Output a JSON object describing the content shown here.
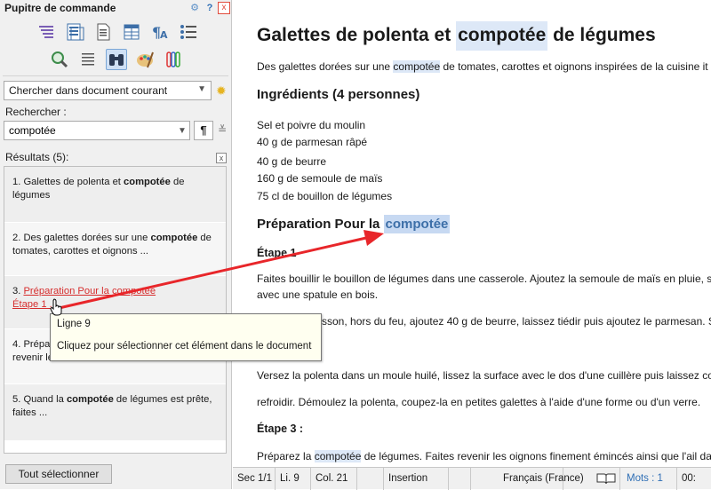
{
  "panel": {
    "title": "Pupitre de commande",
    "close_glyph": "x",
    "help_glyph": "?",
    "scope_select": "Chercher dans document courant",
    "search_label": "Rechercher :",
    "search_value": "compotée",
    "results_label": "Résultats (5):",
    "select_all_label": "Tout sélectionner",
    "results": [
      {
        "prefix": "1. Galettes de polenta et ",
        "match": "compotée",
        "suffix": " de légumes"
      },
      {
        "prefix": "2. Des galettes dorées sur une ",
        "match": "compotée",
        "suffix": " de tomates, carottes et oignons ..."
      },
      {
        "prefix": "3. ",
        "link": "Préparation Pour la compotée",
        "line2": "Étape 1 ..."
      },
      {
        "prefix": "4. Prépar",
        "line2": "revenir le"
      },
      {
        "prefix": "5. Quand la ",
        "match": "compotée",
        "suffix": " de légumes est prête, faites ..."
      }
    ],
    "tooltip": {
      "line1": "Ligne 9",
      "line2": "Cliquez pour sélectionner cet élément dans le document"
    }
  },
  "document": {
    "title_pre": "Galettes de polenta et ",
    "title_match": "compotée",
    "title_post": " de légumes",
    "intro_pre": "Des galettes dorées sur une ",
    "intro_match": "compotée",
    "intro_post": " de tomates, carottes et oignons inspirées de la cuisine it",
    "ingredients_heading": "Ingrédients (4 personnes)",
    "ingredients": [
      "Sel et poivre du moulin",
      "40 g de parmesan râpé",
      "40 g de beurre",
      "160 g de semoule de maïs",
      "75 cl de bouillon de légumes"
    ],
    "prep_heading_pre": "Préparation Pour la ",
    "prep_heading_match": "compotée",
    "step1": "Étape 1",
    "step1_text1": "Faites bouillir le bouillon de légumes dans une casserole. Ajoutez la semoule de maïs en pluie, s",
    "step1_text2": "avec une spatule en bois.",
    "step1_text3": "sson, hors du feu, ajoutez 40 g de beurre, laissez tiédir puis ajoutez le parmesan. Sa",
    "step2_text1": "Versez la polenta dans un moule huilé, lissez la surface avec le dos d'une cuillère puis laissez co",
    "step2_text2": "refroidir. Démoulez la polenta, coupez-la en petites galettes à l'aide d'une forme ou d'un verre.",
    "step3": "Étape 3 :",
    "step3_pre": "Préparez la ",
    "step3_match": "compotée",
    "step3_post": " de légumes. Faites revenir les oignons finement émincés ainsi que l'ail da"
  },
  "status": {
    "section": "Sec 1/1",
    "line": "Li. 9",
    "col": "Col. 21",
    "mode": "Insertion",
    "language": "Français (France)",
    "words": "Mots : 1",
    "time": "00:"
  },
  "colors": {
    "arrow": "#e8262a",
    "link_hover": "#d62d2d",
    "match_bg": "#dde8f7"
  }
}
